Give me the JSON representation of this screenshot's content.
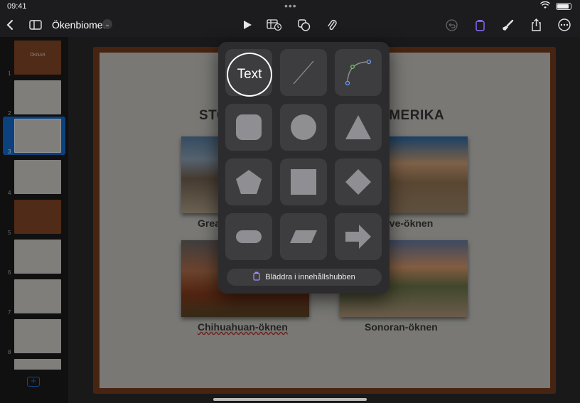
{
  "status": {
    "time": "09:41",
    "dots": "•••"
  },
  "toolbar": {
    "doc_title": "Ökenbiomet",
    "back_icon": "chevron-left-icon",
    "sidebar_icon": "sidebar-icon",
    "play_icon": "play-icon",
    "table_icon": "table-icon",
    "shapes_icon": "shapes-icon",
    "attach_icon": "paperclip-icon",
    "undo_icon": "undo-icon",
    "library_icon": "library-icon",
    "format_icon": "paintbrush-icon",
    "share_icon": "share-icon",
    "more_icon": "ellipsis-icon",
    "accent": "#8e6bff"
  },
  "sidebar": {
    "slides": [
      {
        "num": "1",
        "title": "ÖKNAR"
      },
      {
        "num": "2"
      },
      {
        "num": "3",
        "selected": true
      },
      {
        "num": "4"
      },
      {
        "num": "5"
      },
      {
        "num": "6"
      },
      {
        "num": "7"
      },
      {
        "num": "8"
      }
    ],
    "add_icon": "plus-icon"
  },
  "slide": {
    "title_left": "STO",
    "title_right": "AMERIKA",
    "captions": [
      "Grea",
      "ave-öknen",
      "Chihuahuan-öknen",
      "Sonoran-öknen"
    ]
  },
  "popover": {
    "text_label": "Text",
    "shapes": [
      "line-icon",
      "curve-icon",
      "rounded-square-icon",
      "circle-icon",
      "triangle-icon",
      "pentagon-icon",
      "square-icon",
      "diamond-icon",
      "pill-icon",
      "parallelogram-icon",
      "arrow-icon"
    ],
    "hub_label": "Bläddra i innehållshubben",
    "hub_icon": "library-icon"
  }
}
